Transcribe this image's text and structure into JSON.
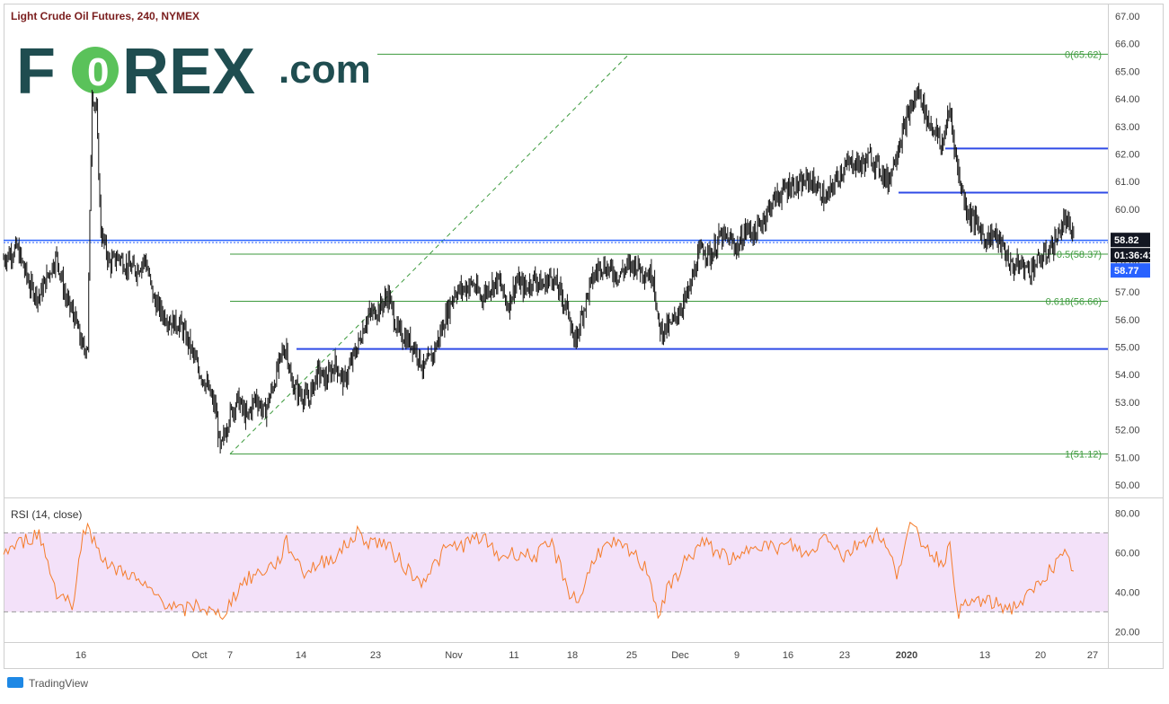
{
  "chart_data": [
    {
      "type": "candlestick",
      "title": "Light Crude Oil Futures, 240, NYMEX",
      "y_ticks": [
        "67.00",
        "66.00",
        "65.00",
        "64.00",
        "63.00",
        "62.00",
        "61.00",
        "60.00",
        "59.00",
        "58.00",
        "57.00",
        "56.00",
        "55.00",
        "54.00",
        "53.00",
        "52.00",
        "51.00",
        "50.00"
      ],
      "ylim": [
        49.5,
        67.4
      ],
      "x_ticks": [
        "16",
        "Oct",
        "7",
        "14",
        "23",
        "Nov",
        "11",
        "18",
        "25",
        "Dec",
        "9",
        "16",
        "23",
        "2020",
        "13",
        "20",
        "27"
      ],
      "price_path": [
        [
          0,
          58.2
        ],
        [
          3,
          58.6
        ],
        [
          6,
          57.2
        ],
        [
          8,
          56.8
        ],
        [
          10,
          57.6
        ],
        [
          12,
          58.3
        ],
        [
          14,
          56.8
        ],
        [
          16,
          56.1
        ],
        [
          18,
          54.9
        ],
        [
          19,
          55.1
        ],
        [
          20,
          64.3
        ],
        [
          21,
          63.5
        ],
        [
          22,
          59.2
        ],
        [
          24,
          58.0
        ],
        [
          26,
          58.3
        ],
        [
          28,
          57.9
        ],
        [
          30,
          57.8
        ],
        [
          32,
          58.2
        ],
        [
          34,
          56.7
        ],
        [
          36,
          56.2
        ],
        [
          38,
          55.9
        ],
        [
          40,
          55.8
        ],
        [
          42,
          55.1
        ],
        [
          44,
          54.2
        ],
        [
          46,
          53.6
        ],
        [
          48,
          52.7
        ],
        [
          49,
          51.2
        ],
        [
          51,
          52.5
        ],
        [
          53,
          53.1
        ],
        [
          55,
          52.4
        ],
        [
          57,
          53.2
        ],
        [
          59,
          52.6
        ],
        [
          61,
          53.6
        ],
        [
          63,
          54.8
        ],
        [
          64,
          55.0
        ],
        [
          65,
          53.7
        ],
        [
          67,
          53.3
        ],
        [
          69,
          53.1
        ],
        [
          71,
          54.1
        ],
        [
          73,
          53.8
        ],
        [
          75,
          54.4
        ],
        [
          77,
          53.7
        ],
        [
          79,
          54.6
        ],
        [
          80,
          55.0
        ],
        [
          82,
          56.0
        ],
        [
          83,
          56.2
        ],
        [
          85,
          56.4
        ],
        [
          87,
          56.9
        ],
        [
          89,
          55.6
        ],
        [
          91,
          55.3
        ],
        [
          93,
          55.0
        ],
        [
          95,
          54.2
        ],
        [
          97,
          54.7
        ],
        [
          99,
          55.6
        ],
        [
          100,
          56.1
        ],
        [
          102,
          57.0
        ],
        [
          104,
          57.1
        ],
        [
          106,
          57.3
        ],
        [
          108,
          56.8
        ],
        [
          110,
          57.2
        ],
        [
          112,
          57.4
        ],
        [
          114,
          56.5
        ],
        [
          116,
          57.4
        ],
        [
          118,
          57.1
        ],
        [
          120,
          57.5
        ],
        [
          122,
          57.2
        ],
        [
          124,
          57.6
        ],
        [
          126,
          56.9
        ],
        [
          128,
          56.2
        ],
        [
          129,
          55.0
        ],
        [
          131,
          56.3
        ],
        [
          133,
          57.4
        ],
        [
          135,
          58.0
        ],
        [
          137,
          57.8
        ],
        [
          139,
          57.6
        ],
        [
          141,
          57.9
        ],
        [
          143,
          58.0
        ],
        [
          145,
          57.7
        ],
        [
          147,
          57.6
        ],
        [
          148,
          55.8
        ],
        [
          149,
          55.6
        ],
        [
          151,
          55.8
        ],
        [
          153,
          56.4
        ],
        [
          155,
          57.0
        ],
        [
          157,
          58.2
        ],
        [
          158,
          58.6
        ],
        [
          160,
          58.3
        ],
        [
          162,
          59.0
        ],
        [
          164,
          58.9
        ],
        [
          166,
          58.6
        ],
        [
          168,
          59.3
        ],
        [
          170,
          59.1
        ],
        [
          172,
          59.7
        ],
        [
          174,
          60.3
        ],
        [
          176,
          60.6
        ],
        [
          178,
          60.9
        ],
        [
          180,
          60.8
        ],
        [
          182,
          61.1
        ],
        [
          184,
          60.8
        ],
        [
          186,
          60.3
        ],
        [
          188,
          61.0
        ],
        [
          190,
          61.5
        ],
        [
          192,
          61.7
        ],
        [
          194,
          61.6
        ],
        [
          196,
          61.9
        ],
        [
          198,
          61.5
        ],
        [
          200,
          61.0
        ],
        [
          202,
          62.1
        ],
        [
          203,
          62.6
        ],
        [
          205,
          63.6
        ],
        [
          207,
          64.3
        ],
        [
          209,
          63.2
        ],
        [
          211,
          62.8
        ],
        [
          212,
          62.2
        ],
        [
          214,
          63.6
        ],
        [
          215,
          62.4
        ],
        [
          216,
          61.2
        ],
        [
          218,
          59.9
        ],
        [
          220,
          59.5
        ],
        [
          222,
          58.9
        ],
        [
          224,
          59.1
        ],
        [
          226,
          58.6
        ],
        [
          228,
          57.9
        ],
        [
          230,
          58.0
        ],
        [
          232,
          57.8
        ],
        [
          234,
          58.1
        ],
        [
          236,
          58.4
        ],
        [
          238,
          58.9
        ],
        [
          240,
          59.6
        ],
        [
          242,
          59.0
        ]
      ],
      "rsi": {
        "label": "RSI (14, close)",
        "y_ticks": [
          "80.00",
          "60.00",
          "40.00",
          "20.00"
        ],
        "ylim": [
          17,
          82
        ],
        "band": [
          30,
          70
        ],
        "path": [
          [
            0,
            60
          ],
          [
            4,
            65
          ],
          [
            8,
            70
          ],
          [
            12,
            40
          ],
          [
            16,
            34
          ],
          [
            18,
            75
          ],
          [
            20,
            68
          ],
          [
            24,
            52
          ],
          [
            28,
            50
          ],
          [
            32,
            42
          ],
          [
            36,
            36
          ],
          [
            40,
            30
          ],
          [
            44,
            34
          ],
          [
            48,
            28
          ],
          [
            50,
            30
          ],
          [
            54,
            45
          ],
          [
            58,
            50
          ],
          [
            62,
            55
          ],
          [
            64,
            65
          ],
          [
            68,
            50
          ],
          [
            72,
            55
          ],
          [
            76,
            60
          ],
          [
            80,
            70
          ],
          [
            82,
            66
          ],
          [
            86,
            65
          ],
          [
            90,
            55
          ],
          [
            94,
            45
          ],
          [
            98,
            55
          ],
          [
            100,
            62
          ],
          [
            104,
            64
          ],
          [
            108,
            68
          ],
          [
            112,
            58
          ],
          [
            116,
            60
          ],
          [
            120,
            58
          ],
          [
            124,
            64
          ],
          [
            128,
            40
          ],
          [
            130,
            35
          ],
          [
            134,
            60
          ],
          [
            138,
            64
          ],
          [
            142,
            60
          ],
          [
            146,
            50
          ],
          [
            148,
            28
          ],
          [
            150,
            40
          ],
          [
            154,
            55
          ],
          [
            158,
            65
          ],
          [
            162,
            60
          ],
          [
            166,
            55
          ],
          [
            170,
            66
          ],
          [
            174,
            62
          ],
          [
            178,
            64
          ],
          [
            182,
            58
          ],
          [
            186,
            70
          ],
          [
            190,
            58
          ],
          [
            194,
            66
          ],
          [
            198,
            70
          ],
          [
            202,
            50
          ],
          [
            205,
            73
          ],
          [
            208,
            65
          ],
          [
            212,
            55
          ],
          [
            214,
            62
          ],
          [
            216,
            30
          ],
          [
            220,
            36
          ],
          [
            224,
            34
          ],
          [
            228,
            32
          ],
          [
            232,
            38
          ],
          [
            236,
            50
          ],
          [
            240,
            58
          ],
          [
            242,
            52
          ]
        ]
      },
      "fib_levels": [
        {
          "label": "0(65.62)",
          "value": 65.62
        },
        {
          "label": "0.5(58.37)",
          "value": 58.37
        },
        {
          "label": "0.618(56.66)",
          "value": 56.66
        },
        {
          "label": "1(51.12)",
          "value": 51.12
        }
      ],
      "horizontal_levels": [
        58.82,
        54.93,
        60.6,
        62.2
      ],
      "price_badges": [
        {
          "text": "58.82",
          "color": "#131722"
        },
        {
          "text": "01:36:41",
          "color": "#131722"
        },
        {
          "text": "58.77",
          "color": "#2962ff"
        }
      ],
      "colors": {
        "candle": "#111111",
        "fib": "#3c9a3c",
        "levels": "#2f4be6",
        "rsi": "#f57c2a",
        "rsi_band": "#f3e1f9",
        "price_line": "#2962ff"
      }
    }
  ],
  "logo": {
    "fo": "F",
    "o": "O",
    "rex": "REX",
    "dotcom": ".com",
    "colors": {
      "dark": "#1f4d50",
      "green": "#5ac25a"
    }
  },
  "footer": {
    "brand": "TradingView"
  }
}
